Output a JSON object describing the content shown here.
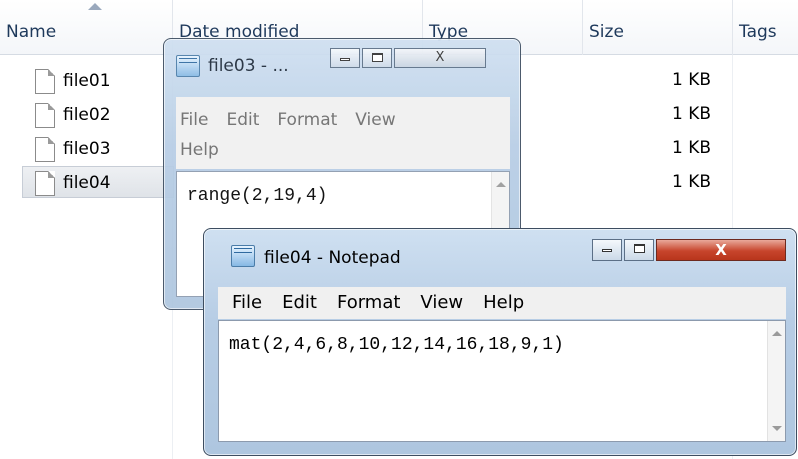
{
  "explorer": {
    "columns": [
      "Name",
      "Date modified",
      "Type",
      "Size",
      "Tags"
    ],
    "files": [
      {
        "name": "file01",
        "size": "1 KB",
        "selected": false
      },
      {
        "name": "file02",
        "size": "1 KB",
        "selected": false
      },
      {
        "name": "file03",
        "size": "1 KB",
        "selected": false
      },
      {
        "name": "file04",
        "size": "1 KB",
        "selected": true
      }
    ]
  },
  "window_back": {
    "title": "file03 - ...",
    "menu": [
      "File",
      "Edit",
      "Format",
      "View",
      "Help"
    ],
    "content": "range(2,19,4)"
  },
  "window_front": {
    "title": "file04 - Notepad",
    "menu": [
      "File",
      "Edit",
      "Format",
      "View",
      "Help"
    ],
    "content": "mat(2,4,6,8,10,12,14,16,18,9,1)",
    "close_glyph": "X"
  }
}
